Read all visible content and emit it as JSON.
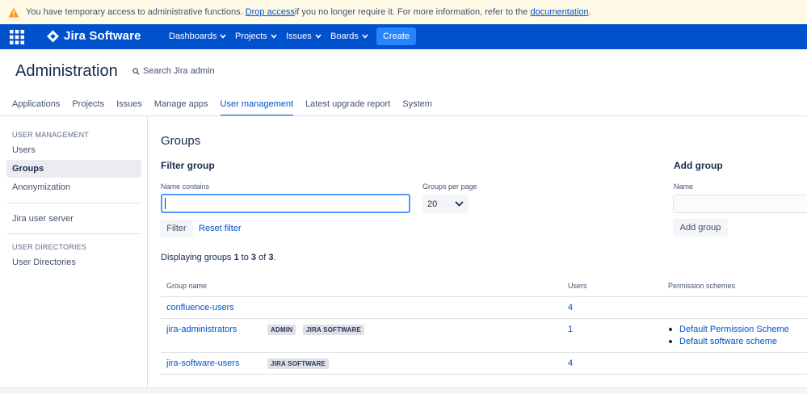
{
  "banner": {
    "text_before": "You have temporary access to administrative functions. ",
    "drop_link": "Drop access",
    "text_middle": " if you no longer require it. For more information, refer to the ",
    "doc_link": "documentation",
    "text_after": ".",
    "icon": "warning-icon"
  },
  "topnav": {
    "logo_text": "Jira Software",
    "items": [
      {
        "label": "Dashboards"
      },
      {
        "label": "Projects"
      },
      {
        "label": "Issues"
      },
      {
        "label": "Boards"
      }
    ],
    "create_label": "Create",
    "colors": {
      "bar": "#0052cc",
      "create": "#2684ff"
    }
  },
  "admin": {
    "title": "Administration",
    "search_label": "Search Jira admin",
    "tabs": [
      {
        "label": "Applications"
      },
      {
        "label": "Projects"
      },
      {
        "label": "Issues"
      },
      {
        "label": "Manage apps"
      },
      {
        "label": "User management",
        "active": true
      },
      {
        "label": "Latest upgrade report"
      },
      {
        "label": "System"
      }
    ]
  },
  "sidebar": {
    "heading_user_management": "USER MANAGEMENT",
    "items": [
      {
        "label": "Users"
      },
      {
        "label": "Groups",
        "selected": true
      },
      {
        "label": "Anonymization"
      }
    ],
    "jira_user_server": "Jira user server",
    "heading_user_directories": "USER DIRECTORIES",
    "user_directories": "User Directories"
  },
  "main": {
    "page_title": "Groups",
    "filter": {
      "heading": "Filter group",
      "name_label": "Name contains",
      "name_value": "",
      "per_page_label": "Groups per page",
      "per_page_value": "20",
      "filter_button": "Filter",
      "reset_link": "Reset filter"
    },
    "add": {
      "heading": "Add group",
      "name_label": "Name",
      "name_value": "",
      "add_button": "Add group"
    },
    "displaying": {
      "prefix": "Displaying groups ",
      "from": "1",
      "to_word": " to ",
      "to": "3",
      "of_word": " of ",
      "total": "3",
      "suffix": "."
    },
    "table": {
      "headers": {
        "group_name": "Group name",
        "users": "Users",
        "schemes": "Permission schemes"
      },
      "rows": [
        {
          "name": "confluence-users",
          "badges": [],
          "users": "4",
          "schemes": []
        },
        {
          "name": "jira-administrators",
          "badges": [
            "ADMIN",
            "JIRA SOFTWARE"
          ],
          "users": "1",
          "schemes": [
            "Default Permission Scheme",
            "Default software scheme"
          ]
        },
        {
          "name": "jira-software-users",
          "badges": [
            "JIRA SOFTWARE"
          ],
          "users": "4",
          "schemes": []
        }
      ]
    }
  }
}
